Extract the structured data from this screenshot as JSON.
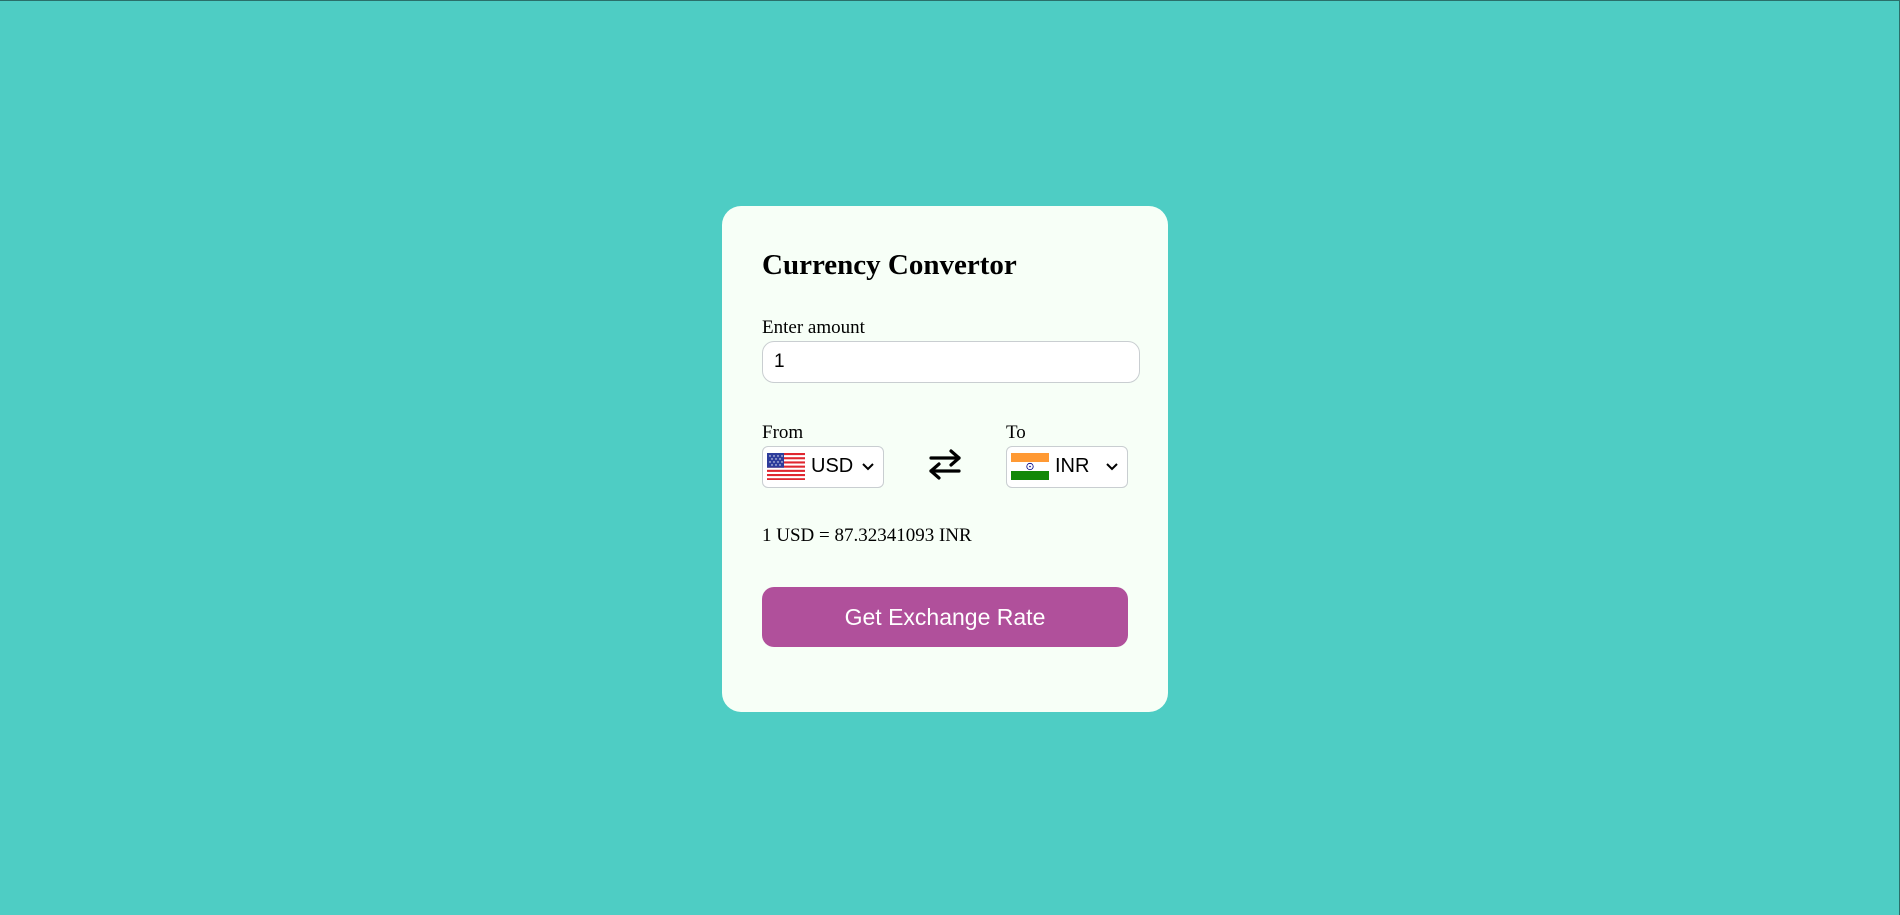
{
  "page": {
    "background_color": "#4ecdc4",
    "card_color": "#f7fff7",
    "accent_color": "#b0509b"
  },
  "card": {
    "title": "Currency Convertor",
    "amount_label": "Enter amount",
    "amount_value": "1",
    "from": {
      "label": "From",
      "currency": "USD",
      "flag_icon": "us-flag-icon"
    },
    "to": {
      "label": "To",
      "currency": "INR",
      "flag_icon": "india-flag-icon"
    },
    "swap_icon": "swap-arrows-icon",
    "result_text": "1 USD = 87.32341093 INR",
    "button_label": "Get Exchange Rate"
  }
}
